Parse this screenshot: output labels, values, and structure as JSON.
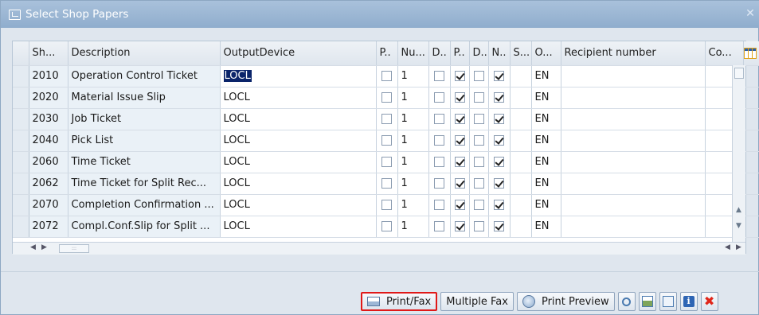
{
  "window": {
    "title": "Select Shop Papers"
  },
  "columns": [
    "Sh...",
    "Description",
    "OutputDevice",
    "P..",
    "Nu...",
    "D..",
    "P..",
    "D..",
    "N..",
    "S...",
    "O...",
    "Recipient number",
    "Co..."
  ],
  "rows": [
    {
      "sh": "2010",
      "description": "Operation Control Ticket",
      "device": "LOCL",
      "num": "1",
      "lang": "EN"
    },
    {
      "sh": "2020",
      "description": "Material Issue Slip",
      "device": "LOCL",
      "num": "1",
      "lang": "EN"
    },
    {
      "sh": "2030",
      "description": "Job Ticket",
      "device": "LOCL",
      "num": "1",
      "lang": "EN"
    },
    {
      "sh": "2040",
      "description": "Pick List",
      "device": "LOCL",
      "num": "1",
      "lang": "EN"
    },
    {
      "sh": "2060",
      "description": "Time Ticket",
      "device": "LOCL",
      "num": "1",
      "lang": "EN"
    },
    {
      "sh": "2062",
      "description": "Time Ticket for Split Rec...",
      "device": "LOCL",
      "num": "1",
      "lang": "EN"
    },
    {
      "sh": "2070",
      "description": "Completion Confirmation ...",
      "device": "LOCL",
      "num": "1",
      "lang": "EN"
    },
    {
      "sh": "2072",
      "description": "Compl.Conf.Slip for Split ...",
      "device": "LOCL",
      "num": "1",
      "lang": "EN"
    }
  ],
  "toolbar": {
    "print_fax": "Print/Fax",
    "multiple_fax": "Multiple Fax",
    "print_preview": "Print Preview",
    "info": "i"
  },
  "colors": {
    "title_bar": "#9bb6d4",
    "highlight_border": "#e01818",
    "selection": "#0a246a"
  }
}
